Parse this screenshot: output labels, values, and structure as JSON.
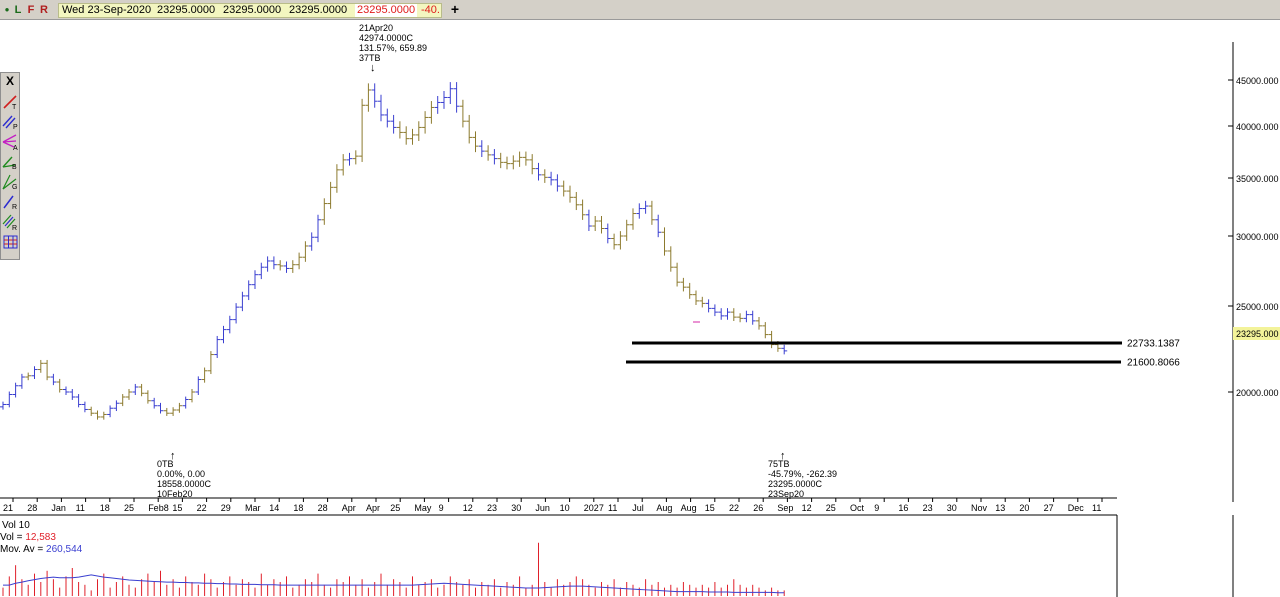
{
  "toolbar": {
    "buttons": [
      {
        "id": "dot",
        "label": "●"
      },
      {
        "id": "l",
        "label": "L"
      },
      {
        "id": "f",
        "label": "F"
      },
      {
        "id": "r",
        "label": "R"
      }
    ],
    "date": "Wed 23-Sep-2020",
    "open": "23295.0000",
    "high": "23295.0000",
    "low": "23295.0000",
    "close": "23295.0000",
    "change": "-40.",
    "add_label": "+"
  },
  "tools": [
    {
      "name": "trend-line-tool",
      "letter": "T"
    },
    {
      "name": "parallel-lines-tool",
      "letter": "P"
    },
    {
      "name": "andrews-fork-tool",
      "letter": "A"
    },
    {
      "name": "b-line-tool",
      "letter": "B"
    },
    {
      "name": "gann-fan-tool",
      "letter": "G"
    },
    {
      "name": "retracement-tool",
      "letter": "R"
    },
    {
      "name": "regression-channel-tool",
      "letter": "R"
    },
    {
      "name": "grid-tool",
      "letter": ""
    }
  ],
  "close_label": "X",
  "colors": {
    "up": "#3a3fd0",
    "down": "#8c7a2e",
    "hline": "#000000",
    "vol": "#e0202a",
    "ma": "#3a3fd0",
    "pink": "#e36fc4"
  },
  "price_axis": {
    "ticks": [
      "45000.000",
      "40000.000",
      "35000.000",
      "30000.000",
      "25000.000",
      "20000.000"
    ],
    "current": "23295.000"
  },
  "annotations": {
    "peak": {
      "lines": [
        "21Apr20",
        "42974.0000C",
        "131.57%, 659.89",
        "37TB"
      ],
      "arrow": "↓"
    },
    "start": {
      "arrow": "↑",
      "lines": [
        "0TB",
        "0.00%, 0.00",
        "18558.0000C",
        "10Feb20"
      ]
    },
    "end": {
      "arrow": "↑",
      "lines": [
        "75TB",
        "-45.79%, -262.39",
        "23295.0000C",
        "23Sep20"
      ]
    }
  },
  "hlines": [
    {
      "label": "22733.1387"
    },
    {
      "label": "21600.8066"
    }
  ],
  "date_axis": [
    "21",
    "28",
    "Jan",
    "11",
    "18",
    "25",
    "Feb8",
    "15",
    "22",
    "29",
    "Mar",
    "14",
    "18",
    "28",
    "Apr",
    "Apr",
    "25",
    "May",
    "9",
    "12",
    "23",
    "30",
    "Jun",
    "10",
    "2027",
    "11",
    "Jul",
    "Aug",
    "Aug",
    "15",
    "22",
    "26",
    "Sep",
    "12",
    "25",
    "Oct",
    "9",
    "16",
    "23",
    "30",
    "Nov",
    "13",
    "20",
    "27",
    "Dec",
    "11"
  ],
  "volume": {
    "title": "Vol 10",
    "vol_label": "Vol = ",
    "vol_value": "12,583",
    "ma_label": "Mov. Av = ",
    "ma_value": "260,544"
  },
  "chart_data": {
    "type": "bar",
    "price_series": {
      "price_scale": [
        20000,
        45000
      ],
      "values": [
        19000,
        19800,
        20500,
        21200,
        21300,
        21800,
        22300,
        21200,
        20800,
        20200,
        20000,
        19600,
        19000,
        18600,
        18300,
        18000,
        18200,
        18700,
        19100,
        19600,
        20000,
        20400,
        19900,
        19300,
        18900,
        18500,
        18300,
        18558,
        18900,
        19400,
        20000,
        21000,
        21700,
        23000,
        24200,
        25000,
        25800,
        26800,
        27700,
        28600,
        29400,
        30000,
        30500,
        30200,
        30100,
        29900,
        30200,
        30800,
        31700,
        32400,
        33800,
        35100,
        36400,
        37800,
        38600,
        38700,
        38900,
        42974,
        44200,
        43300,
        42200,
        41700,
        41200,
        40800,
        40300,
        40600,
        41200,
        42000,
        42800,
        43200,
        43600,
        44300,
        42900,
        41700,
        40400,
        39700,
        39300,
        39000,
        38700,
        38400,
        38300,
        38500,
        38800,
        38600,
        37900,
        37400,
        37200,
        37000,
        36500,
        36100,
        35600,
        35000,
        34200,
        33300,
        33700,
        33100,
        32300,
        31800,
        32500,
        33400,
        34300,
        34700,
        34900,
        33800,
        32800,
        31300,
        30000,
        28800,
        28400,
        27800,
        27300,
        27100,
        26700,
        26400,
        26100,
        26400,
        26000,
        25900,
        26200,
        25700,
        25300,
        24600,
        23800,
        23500,
        23295
      ],
      "directions": "uuuududduduuuuddduuddudduudddududduuuuuuuuuududdduudddduddduuuudddddduuuudddududddddduduudddduddudddduududdddddduuuudduuddddu",
      "last_day": "23Sep20",
      "last_close": 23295
    },
    "hlines": [
      22733.1387,
      21600.8066
    ],
    "volume_bars": [
      0.3,
      0.7,
      1.1,
      0.6,
      0.4,
      0.8,
      0.5,
      0.9,
      0.6,
      0.3,
      0.7,
      1.0,
      0.5,
      0.4,
      0.2,
      0.6,
      0.8,
      0.3,
      0.5,
      0.7,
      0.4,
      0.3,
      0.6,
      0.8,
      0.5,
      0.9,
      0.4,
      0.6,
      0.3,
      0.7,
      0.5,
      0.4,
      0.8,
      0.6,
      0.3,
      0.5,
      0.7,
      0.4,
      0.6,
      0.5,
      0.3,
      0.8,
      0.4,
      0.6,
      0.5,
      0.7,
      0.3,
      0.4,
      0.6,
      0.5,
      0.8,
      0.4,
      0.3,
      0.6,
      0.5,
      0.7,
      0.4,
      0.6,
      0.3,
      0.5,
      0.8,
      0.4,
      0.6,
      0.5,
      0.3,
      0.7,
      0.4,
      0.5,
      0.6,
      0.3,
      0.4,
      0.7,
      0.5,
      0.4,
      0.6,
      0.3,
      0.5,
      0.4,
      0.6,
      0.3,
      0.5,
      0.4,
      0.7,
      0.3,
      0.4,
      1.9,
      0.5,
      0.3,
      0.6,
      0.4,
      0.5,
      0.7,
      0.6,
      0.4,
      0.3,
      0.5,
      0.4,
      0.6,
      0.3,
      0.5,
      0.4,
      0.3,
      0.6,
      0.4,
      0.5,
      0.3,
      0.4,
      0.3,
      0.5,
      0.4,
      0.3,
      0.4,
      0.3,
      0.5,
      0.3,
      0.4,
      0.6,
      0.4,
      0.3,
      0.4,
      0.3,
      0.2,
      0.3,
      0.2,
      0.2
    ],
    "moving_average": [
      0.3,
      0.3,
      0.35,
      0.38,
      0.42,
      0.45,
      0.48,
      0.5,
      0.52,
      0.5,
      0.5,
      0.5,
      0.52,
      0.55,
      0.58,
      0.55,
      0.52,
      0.5,
      0.48,
      0.46,
      0.44,
      0.43,
      0.42,
      0.41,
      0.4,
      0.39,
      0.38,
      0.38,
      0.37,
      0.37,
      0.36,
      0.36,
      0.35,
      0.35,
      0.34,
      0.34,
      0.33,
      0.33,
      0.32,
      0.32,
      0.32,
      0.31,
      0.31,
      0.31,
      0.3,
      0.3,
      0.3,
      0.3,
      0.3,
      0.3,
      0.3,
      0.3,
      0.3,
      0.3,
      0.3,
      0.3,
      0.3,
      0.3,
      0.3,
      0.3,
      0.3,
      0.3,
      0.3,
      0.3,
      0.3,
      0.3,
      0.31,
      0.32,
      0.33,
      0.34,
      0.35,
      0.34,
      0.33,
      0.32,
      0.31,
      0.3,
      0.29,
      0.28,
      0.27,
      0.26,
      0.25,
      0.24,
      0.23,
      0.22,
      0.22,
      0.22,
      0.23,
      0.24,
      0.25,
      0.26,
      0.27,
      0.27,
      0.27,
      0.26,
      0.25,
      0.24,
      0.23,
      0.22,
      0.21,
      0.2,
      0.19,
      0.18,
      0.17,
      0.16,
      0.15,
      0.14,
      0.13,
      0.12,
      0.12,
      0.12,
      0.12,
      0.12,
      0.11,
      0.11,
      0.11,
      0.11,
      0.1,
      0.1,
      0.1,
      0.1,
      0.1,
      0.1,
      0.1,
      0.09,
      0.09
    ]
  }
}
